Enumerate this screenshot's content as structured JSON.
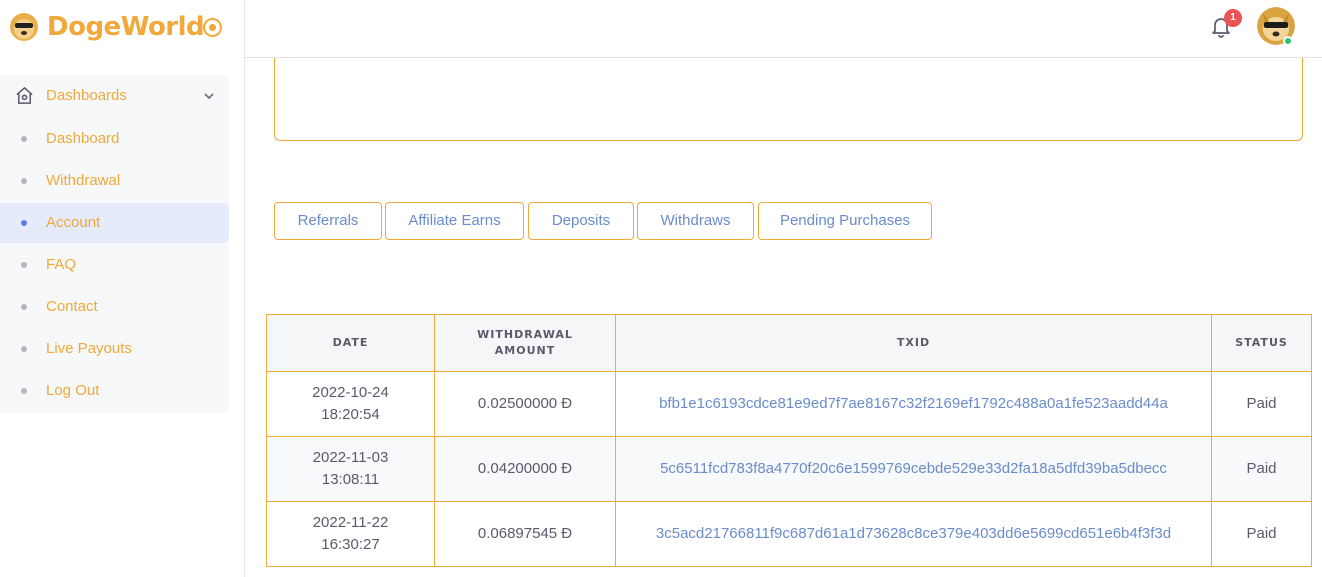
{
  "brand": {
    "name": "DogeWorld",
    "color": "#f0a93a"
  },
  "sidebar": {
    "group_label": "Dashboards",
    "items": [
      {
        "label": "Dashboard",
        "active": false
      },
      {
        "label": "Withdrawal",
        "active": false
      },
      {
        "label": "Account",
        "active": true
      },
      {
        "label": "FAQ",
        "active": false
      },
      {
        "label": "Contact",
        "active": false
      },
      {
        "label": "Live Payouts",
        "active": false
      },
      {
        "label": "Log Out",
        "active": false
      }
    ]
  },
  "topbar": {
    "notification_count": "1",
    "icons": [
      "bell-icon",
      "avatar"
    ]
  },
  "tabs": [
    {
      "label": "Referrals"
    },
    {
      "label": "Affiliate Earns"
    },
    {
      "label": "Deposits"
    },
    {
      "label": "Withdraws"
    },
    {
      "label": "Pending Purchases"
    }
  ],
  "table": {
    "headers": [
      "DATE",
      "WITHDRAWAL AMOUNT",
      "TXID",
      "STATUS"
    ],
    "rows": [
      {
        "date": "2022-10-24",
        "time": "18:20:54",
        "amount": "0.02500000 Đ",
        "txid": "bfb1e1c6193cdce81e9ed7f7ae8167c32f2169ef1792c488a0a1fe523aadd44a",
        "status": "Paid"
      },
      {
        "date": "2022-11-03",
        "time": "13:08:11",
        "amount": "0.04200000 Đ",
        "txid": "5c6511fcd783f8a4770f20c6e1599769cebde529e33d2fa18a5dfd39ba5dbecc",
        "status": "Paid"
      },
      {
        "date": "2022-11-22",
        "time": "16:30:27",
        "amount": "0.06897545 Đ",
        "txid": "3c5acd21766811f9c687d61a1d73628c8ce379e403dd6e5699cd651e6b4f3f3d",
        "status": "Paid"
      }
    ]
  }
}
